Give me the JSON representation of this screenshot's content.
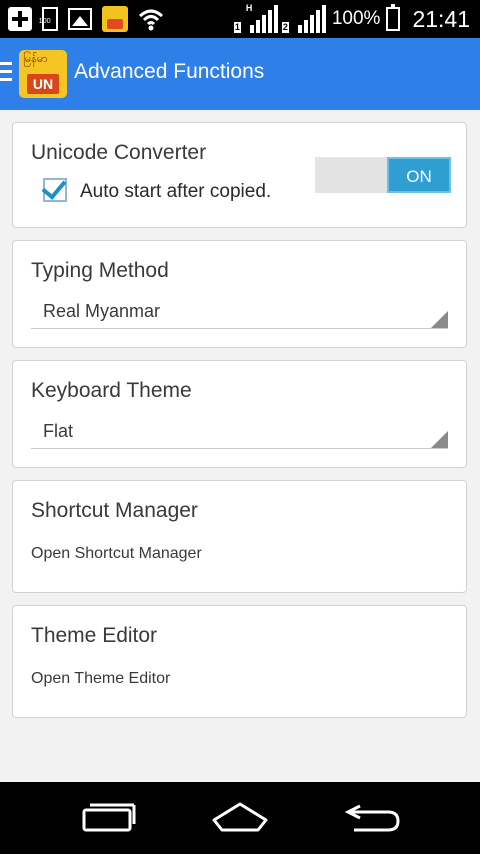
{
  "status_bar": {
    "battery_percent": "100%",
    "time": "21:41",
    "battery_small_label": "100",
    "sim1_label": "1",
    "sim2_label": "2",
    "network_type": "H",
    "icons": [
      "plus-icon",
      "battery-icon",
      "image-icon",
      "app-notification-icon",
      "wifi-icon",
      "signal-icon",
      "battery-icon"
    ]
  },
  "app_bar": {
    "title": "Advanced Functions",
    "logo_top_text": "မြန်မာ",
    "logo_badge": "UN",
    "color": "#2f7fe8"
  },
  "cards": {
    "unicode": {
      "title": "Unicode Converter",
      "checkbox_label": "Auto start after copied.",
      "checked": true,
      "toggle_label": "ON",
      "toggle_on": true
    },
    "typing": {
      "title": "Typing Method",
      "value": "Real Myanmar"
    },
    "theme": {
      "title": "Keyboard Theme",
      "value": "Flat"
    },
    "shortcut": {
      "title": "Shortcut Manager",
      "subtitle": "Open Shortcut Manager"
    },
    "editor": {
      "title": "Theme Editor",
      "subtitle": "Open Theme Editor"
    }
  },
  "nav_bar": {
    "buttons": [
      "recents-icon",
      "home-icon",
      "back-icon"
    ]
  }
}
